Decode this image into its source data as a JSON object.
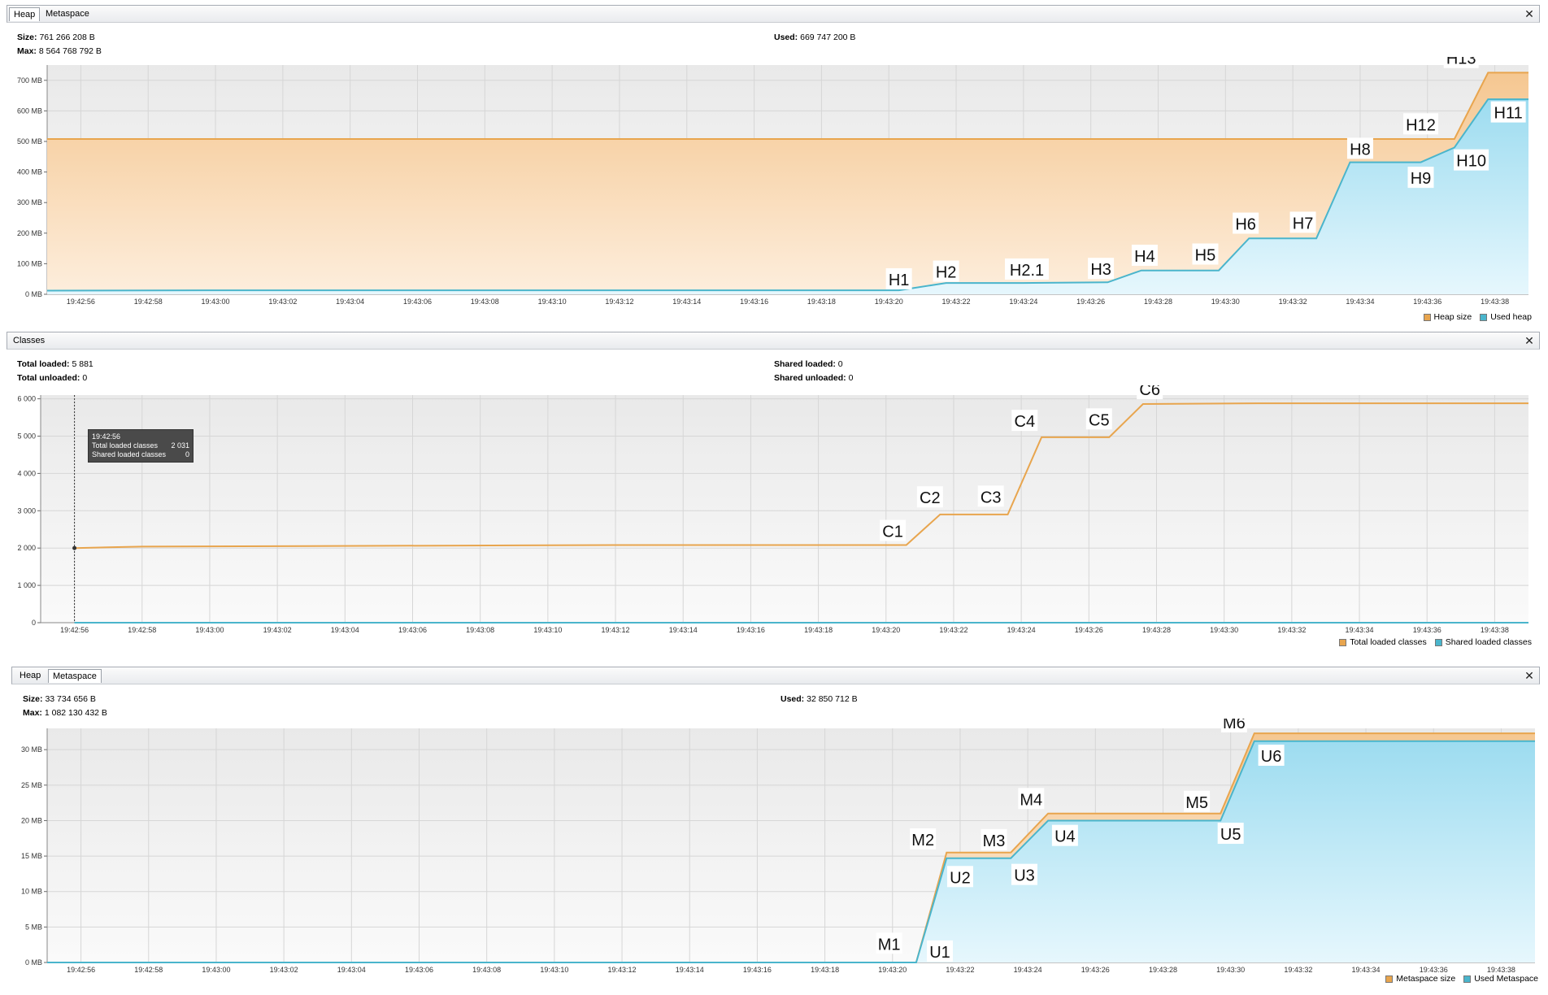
{
  "colors": {
    "orange": "#e8a54e",
    "orange_fill": "#f8cf9c",
    "blue": "#4ab5cc",
    "blue_fill": "#a9e3f3"
  },
  "heap_panel": {
    "tabs": [
      "Heap",
      "Metaspace"
    ],
    "size_label": "Size:",
    "size_value": "761 266 208 B",
    "max_label": "Max:",
    "max_value": "8 564 768 792 B",
    "used_label": "Used:",
    "used_value": "669 747 200 B",
    "legend": [
      "Heap size",
      "Used heap"
    ],
    "chart_data": {
      "type": "area",
      "x": [
        "19:42:55",
        "19:43:00",
        "19:43:20.3",
        "19:43:21.7",
        "19:43:24",
        "19:43:26.5",
        "19:43:27.5",
        "19:43:29.8",
        "19:43:30.7",
        "19:43:32.7",
        "19:43:33.7",
        "19:43:35.8",
        "19:43:36.8",
        "19:43:37.8",
        "19:43:39"
      ],
      "series": [
        {
          "name": "Heap size",
          "values": [
            508,
            508,
            508,
            508,
            508,
            508,
            508,
            508,
            508,
            508,
            508,
            508,
            508,
            725,
            725
          ]
        },
        {
          "name": "Used heap",
          "values": [
            12,
            13,
            13,
            37,
            37,
            39,
            78,
            78,
            183,
            183,
            432,
            432,
            480,
            638,
            638
          ]
        }
      ],
      "y_ticks": [
        "0 MB",
        "100 MB",
        "200 MB",
        "300 MB",
        "400 MB",
        "500 MB",
        "600 MB",
        "700 MB"
      ],
      "x_ticks": [
        "19:42:56",
        "19:42:58",
        "19:43:00",
        "19:43:02",
        "19:43:04",
        "19:43:06",
        "19:43:08",
        "19:43:10",
        "19:43:12",
        "19:43:14",
        "19:43:16",
        "19:43:18",
        "19:43:20",
        "19:43:22",
        "19:43:24",
        "19:43:26",
        "19:43:28",
        "19:43:30",
        "19:43:32",
        "19:43:34",
        "19:43:36",
        "19:43:38"
      ],
      "annotations": [
        "H1",
        "H2",
        "H2.1",
        "H3",
        "H4",
        "H5",
        "H6",
        "H7",
        "H8",
        "H9",
        "H10",
        "H11",
        "H12",
        "H13"
      ]
    }
  },
  "classes_panel": {
    "tab": "Classes",
    "total_loaded_label": "Total loaded:",
    "total_loaded_value": "5 881",
    "total_unloaded_label": "Total unloaded:",
    "total_unloaded_value": "0",
    "shared_loaded_label": "Shared loaded:",
    "shared_loaded_value": "0",
    "shared_unloaded_label": "Shared unloaded:",
    "shared_unloaded_value": "0",
    "legend": [
      "Total loaded classes",
      "Shared loaded classes"
    ],
    "tooltip": {
      "time": "19:42:56",
      "row1_label": "Total loaded classes",
      "row1_value": "2 031",
      "row2_label": "Shared loaded classes",
      "row2_value": "0"
    },
    "chart_data": {
      "type": "line",
      "x": [
        "19:42:56",
        "19:42:58",
        "19:43:12",
        "19:43:20.6",
        "19:43:21.6",
        "19:43:23.6",
        "19:43:24.6",
        "19:43:26.6",
        "19:43:27.6",
        "19:43:31",
        "19:43:39"
      ],
      "series": [
        {
          "name": "Total loaded classes",
          "values": [
            2000,
            2040,
            2080,
            2080,
            2900,
            2900,
            4970,
            4970,
            5860,
            5881,
            5881
          ]
        },
        {
          "name": "Shared loaded classes",
          "values": [
            0,
            0,
            0,
            0,
            0,
            0,
            0,
            0,
            0,
            0,
            0
          ]
        }
      ],
      "y_ticks": [
        "0",
        "1 000",
        "2 000",
        "3 000",
        "4 000",
        "5 000",
        "6 000"
      ],
      "x_ticks": [
        "19:42:56",
        "19:42:58",
        "19:43:00",
        "19:43:02",
        "19:43:04",
        "19:43:06",
        "19:43:08",
        "19:43:10",
        "19:43:12",
        "19:43:14",
        "19:43:16",
        "19:43:18",
        "19:43:20",
        "19:43:22",
        "19:43:24",
        "19:43:26",
        "19:43:28",
        "19:43:30",
        "19:43:32",
        "19:43:34",
        "19:43:36",
        "19:43:38"
      ],
      "annotations": [
        "C1",
        "C2",
        "C3",
        "C4",
        "C5",
        "C6"
      ]
    }
  },
  "meta_panel": {
    "tabs": [
      "Heap",
      "Metaspace"
    ],
    "size_label": "Size:",
    "size_value": "33 734 656 B",
    "max_label": "Max:",
    "max_value": "1 082 130 432 B",
    "used_label": "Used:",
    "used_value": "32 850 712 B",
    "legend": [
      "Metaspace size",
      "Used Metaspace"
    ],
    "chart_data": {
      "type": "area",
      "x": [
        "19:42:55",
        "19:43:20.7",
        "19:43:21.6",
        "19:43:23.5",
        "19:43:24.6",
        "19:43:29.7",
        "19:43:30.7",
        "19:43:39"
      ],
      "series": [
        {
          "name": "Metaspace size",
          "values": [
            0,
            0,
            15.5,
            15.5,
            21,
            21,
            32.3,
            32.3
          ]
        },
        {
          "name": "Used Metaspace",
          "values": [
            0,
            0,
            14.7,
            14.7,
            20,
            20,
            31.2,
            31.2
          ]
        }
      ],
      "y_ticks": [
        "0 MB",
        "5 MB",
        "10 MB",
        "15 MB",
        "20 MB",
        "25 MB",
        "30 MB"
      ],
      "x_ticks": [
        "19:42:56",
        "19:42:58",
        "19:43:00",
        "19:43:02",
        "19:43:04",
        "19:43:06",
        "19:43:08",
        "19:43:10",
        "19:43:12",
        "19:43:14",
        "19:43:16",
        "19:43:18",
        "19:43:20",
        "19:43:22",
        "19:43:24",
        "19:43:26",
        "19:43:28",
        "19:43:30",
        "19:43:32",
        "19:43:34",
        "19:43:36",
        "19:43:38"
      ],
      "annotations": [
        "M1",
        "U1",
        "M2",
        "U2",
        "M3",
        "U3",
        "M4",
        "U4",
        "M5",
        "U5",
        "M6",
        "U6"
      ]
    }
  }
}
